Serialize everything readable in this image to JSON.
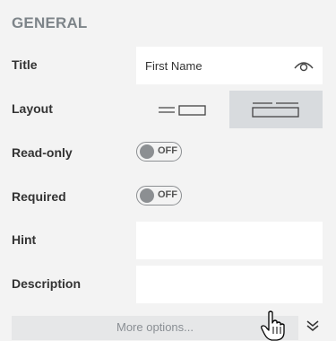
{
  "section": {
    "title": "GENERAL"
  },
  "rows": {
    "title": {
      "label": "Title",
      "value": "First Name",
      "icon": "eye-icon"
    },
    "layout": {
      "label": "Layout",
      "options": [
        "inline-layout",
        "stacked-layout"
      ],
      "selected": "stacked-layout"
    },
    "readonly": {
      "label": "Read-only",
      "toggle_text": "OFF"
    },
    "required": {
      "label": "Required",
      "toggle_text": "OFF"
    },
    "hint": {
      "label": "Hint",
      "value": ""
    },
    "description": {
      "label": "Description",
      "value": ""
    }
  },
  "footer": {
    "more_options_label": "More options...",
    "expand_icon": "double-chevron-down-icon",
    "cursor": "hand-pointer-icon"
  },
  "colors": {
    "background": "#f3f3f3",
    "field": "#ffffff",
    "selected": "#d8dbde",
    "section_title": "#7d8489"
  }
}
